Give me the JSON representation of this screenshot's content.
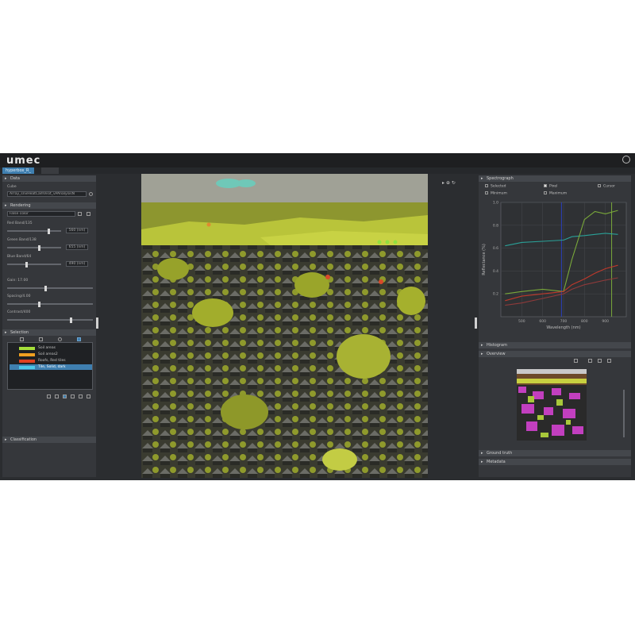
{
  "app": {
    "logo": "umec",
    "tab_label": "hyperbox_R_"
  },
  "left": {
    "sections": {
      "data": "Data",
      "rendering": "Rendering",
      "selection": "Selection",
      "classification": "Classification"
    },
    "data_label": "Cube",
    "data_path": "Array_snvHeatCamVisit_vPAnalysisN",
    "render_mode": "False color",
    "sliders": [
      {
        "label": "Red Band/135",
        "value": "560 (nm)",
        "level": 0.78
      },
      {
        "label": "Green Band/138",
        "value": "655 (nm)",
        "level": 0.6
      },
      {
        "label": "Blue Band/64",
        "value": "490 (nm)",
        "level": 0.35
      }
    ],
    "adjust": [
      {
        "label": "Gain: 17.00",
        "level": 0.45
      },
      {
        "label": "Spacing/4.00",
        "level": 0.37
      },
      {
        "label": "Contrast/400",
        "level": 0.75
      }
    ],
    "selection_rows": [
      {
        "name": "Soil areas",
        "color": "#a6e03a",
        "active": false
      },
      {
        "name": "Soil areas2",
        "color": "#f0a020",
        "active": false
      },
      {
        "name": "Roofs, Red tiles",
        "color": "#e04020",
        "active": false
      },
      {
        "name": "Tile, Solid, dark",
        "color": "#4dc8e8",
        "active": true
      }
    ]
  },
  "right": {
    "sections": {
      "spectrograph": "Spectrograph",
      "histogram": "Histogram",
      "overview": "Overview",
      "ground_truth": "Ground truth",
      "metadata": "Metadata"
    },
    "legend": [
      "Selected",
      "Pixel",
      "Cursor",
      "Minimum",
      "Maximum"
    ]
  },
  "chart_data": {
    "type": "line",
    "title": "",
    "xlabel": "Wavelength (nm)",
    "ylabel": "Reflectance (%)",
    "xlim": [
      400,
      1000
    ],
    "ylim": [
      0,
      1.0
    ],
    "x_ticks": [
      "500",
      "600",
      "700",
      "800",
      "900"
    ],
    "y_ticks": [
      "0.2",
      "0.4",
      "0.6",
      "0.8",
      "1.0"
    ],
    "grid": true,
    "x": [
      420,
      500,
      600,
      700,
      740,
      800,
      850,
      900,
      960
    ],
    "series": [
      {
        "color": "#2aa198",
        "values": [
          0.62,
          0.65,
          0.66,
          0.67,
          0.7,
          0.71,
          0.72,
          0.73,
          0.72
        ]
      },
      {
        "color": "#7aa93a",
        "values": [
          0.2,
          0.22,
          0.24,
          0.22,
          0.5,
          0.85,
          0.92,
          0.9,
          0.93
        ]
      },
      {
        "color": "#c0392b",
        "values": [
          0.14,
          0.18,
          0.2,
          0.22,
          0.28,
          0.33,
          0.38,
          0.42,
          0.45
        ]
      },
      {
        "color": "#8e3a3a",
        "values": [
          0.1,
          0.12,
          0.16,
          0.2,
          0.24,
          0.28,
          0.3,
          0.32,
          0.34
        ]
      }
    ],
    "markers": [
      {
        "x": 690,
        "color": "#2a3fbf"
      },
      {
        "x": 930,
        "color": "#7aa93a"
      }
    ]
  }
}
